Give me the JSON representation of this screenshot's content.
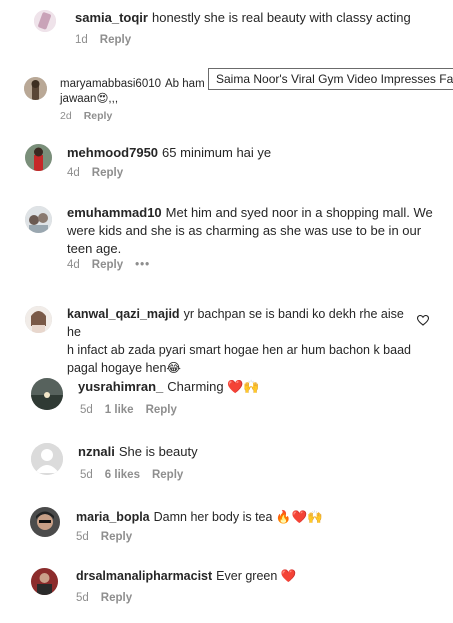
{
  "comments": [
    {
      "user": "samia_toqir",
      "text": "honestly she is real beauty with classy acting",
      "time": "1d",
      "reply": "Reply"
    },
    {
      "user": "maryamabbasi6010",
      "text": "Ab ham b",
      "text2": "jawaan😍,,,",
      "time": "2d",
      "reply": "Reply"
    },
    {
      "user": "mehmood7950",
      "text": "65 minimum hai ye",
      "time": "4d",
      "reply": "Reply"
    },
    {
      "user": "emuhammad10",
      "text": "Met him and syed noor in a shopping mall. We",
      "text2": "were kids and she is as charming as she was use to be in our",
      "text3": "teen age.",
      "time": "4d",
      "reply": "Reply",
      "more": "•••"
    },
    {
      "user": "kanwal_qazi_majid",
      "text": "yr bachpan se is bandi ko dekh rhe aise he",
      "text2": "h infact ab zada pyari smart hogae hen ar hum bachon k baad",
      "text3": "pagal hogaye hen😂",
      "heart_icon": "heart-outline-icon"
    },
    {
      "user": "yusrahimran_",
      "text": "Charming ❤️🙌",
      "time": "5d",
      "likes": "1 like",
      "reply": "Reply"
    },
    {
      "user": "nznali",
      "text": "She is beauty",
      "time": "5d",
      "likes": "6 likes",
      "reply": "Reply"
    },
    {
      "user": "maria_bopla",
      "text": "Damn her body is tea 🔥❤️🙌",
      "time": "5d",
      "reply": "Reply"
    },
    {
      "user": "drsalmanalipharmacist",
      "text": "Ever green ❤️",
      "time": "5d",
      "reply": "Reply"
    }
  ],
  "tooltip": "Saima Noor's Viral Gym Video Impresses Fans"
}
